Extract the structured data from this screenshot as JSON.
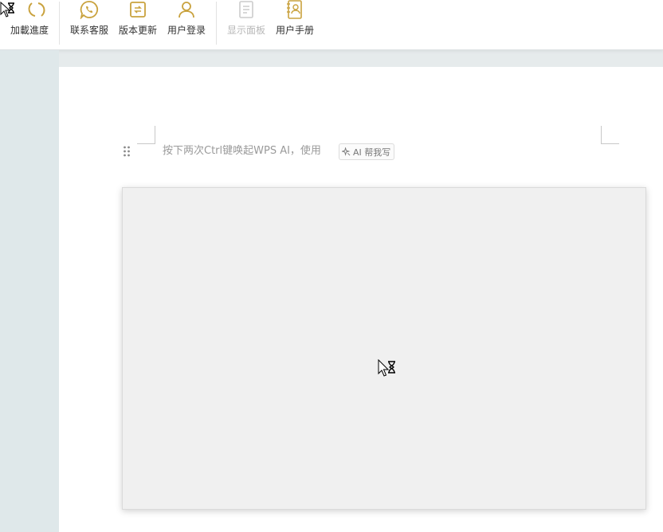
{
  "toolbar": {
    "items": [
      {
        "label": "加載進度",
        "icon": "refresh-icon"
      },
      {
        "label": "联系客服",
        "icon": "chat-icon"
      },
      {
        "label": "版本更新",
        "icon": "update-icon"
      },
      {
        "label": "用户登录",
        "icon": "user-icon"
      },
      {
        "label": "显示面板",
        "icon": "panel-icon",
        "disabled": true
      },
      {
        "label": "用户手册",
        "icon": "manual-icon"
      }
    ]
  },
  "document": {
    "hint_text": "按下两次Ctrl键唤起WPS AI，使用",
    "ai_chip_label": "AI 帮我写"
  },
  "colors": {
    "accent": "#c9a23e",
    "disabled": "#cccccc",
    "page_bg": "#ffffff",
    "gutter_bg": "#dfe8ea"
  },
  "cursor": {
    "state": "busy",
    "icon": "busy-cursor-icon"
  }
}
